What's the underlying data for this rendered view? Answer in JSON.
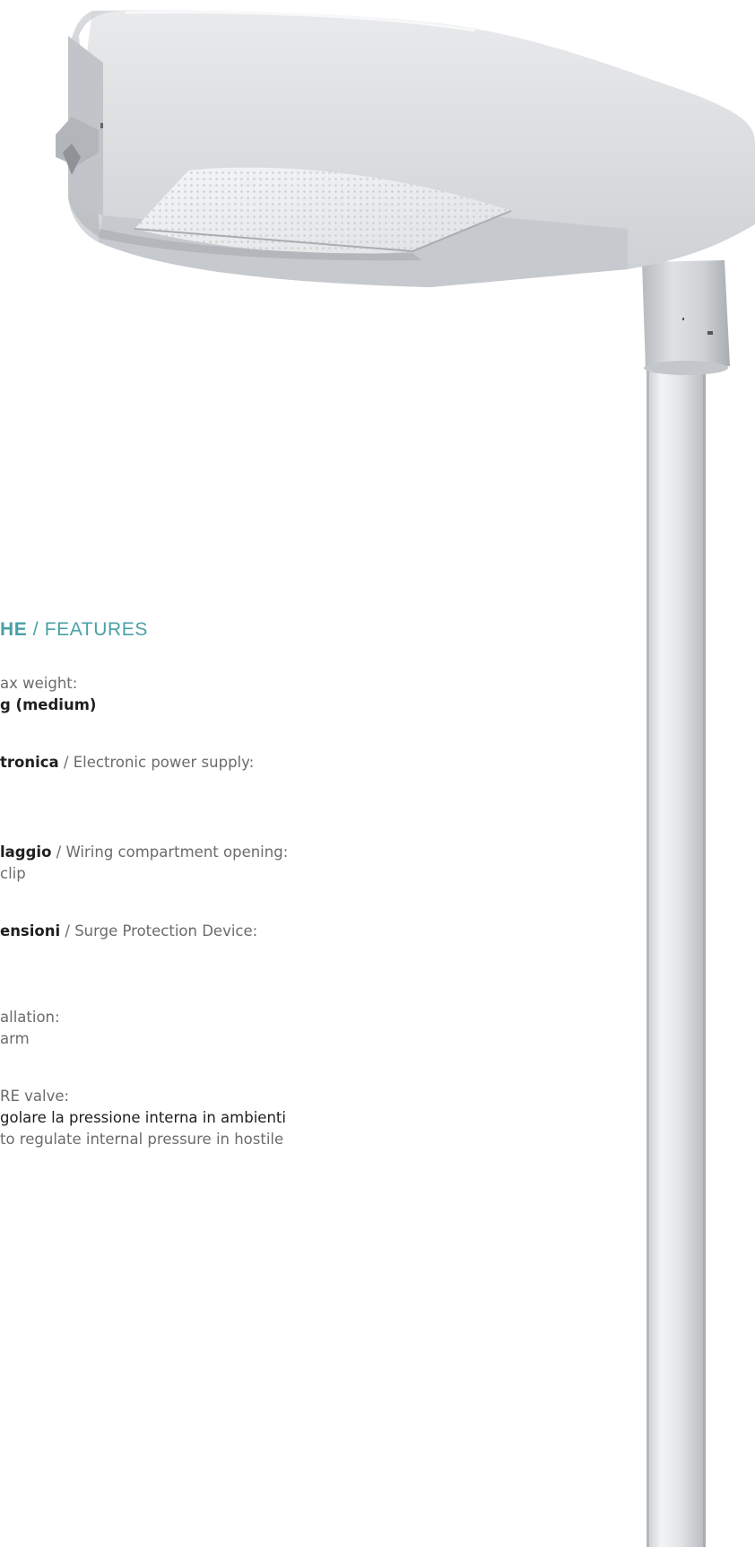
{
  "features": {
    "title_bold": "HE",
    "title_separator": " / ",
    "title_light": "FEATURES",
    "items": [
      {
        "label_it": "",
        "label_en": "ax weight:",
        "value_it": "g (medium)",
        "value_en": ""
      },
      {
        "label_it": "tronica",
        "label_en": " / Electronic power supply:",
        "value_it": "",
        "value_en": ""
      },
      {
        "label_it": "laggio",
        "label_en": " / Wiring compartment opening:",
        "value_it": "",
        "value_en": "clip"
      },
      {
        "label_it": "ensioni",
        "label_en": " / Surge Protection Device:",
        "value_it": "",
        "value_en": ""
      },
      {
        "label_it": "",
        "label_en": "allation:",
        "value_it": "",
        "value_en": "arm"
      },
      {
        "label_it": "",
        "label_en": "RE valve:",
        "value_it": "golare la pressione interna in ambienti",
        "value_en": "to regulate internal pressure in hostile"
      }
    ]
  },
  "colors": {
    "accent": "#4aa0a7",
    "text_dark": "#1f1f1f",
    "text_gray": "#6b6b6b",
    "fixture_body": "#d8dadd",
    "pole": "#e2e4e6"
  }
}
